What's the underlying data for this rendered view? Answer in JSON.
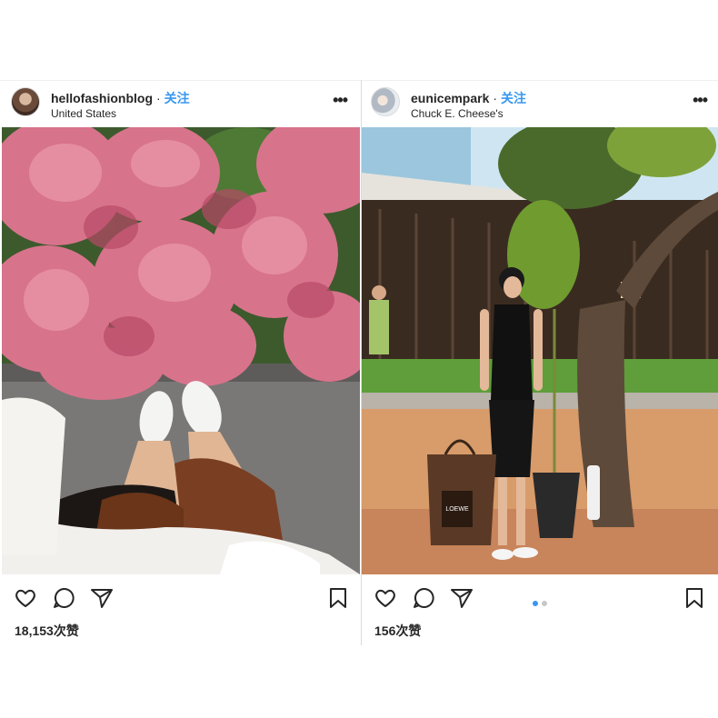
{
  "posts": [
    {
      "username": "hellofashionblog",
      "separator": "·",
      "follow_label": "关注",
      "location": "United States",
      "more_label": "•••",
      "likes": "18,153次赞"
    },
    {
      "username": "eunicempark",
      "separator": "·",
      "follow_label": "关注",
      "location": "Chuck E. Cheese's",
      "more_label": "•••",
      "likes": "156次赞",
      "bag_text": "LOEWE"
    }
  ],
  "colors": {
    "follow": "#3897f0",
    "carousel_active": "#3897f0",
    "carousel_inactive": "#c7c7c7"
  }
}
